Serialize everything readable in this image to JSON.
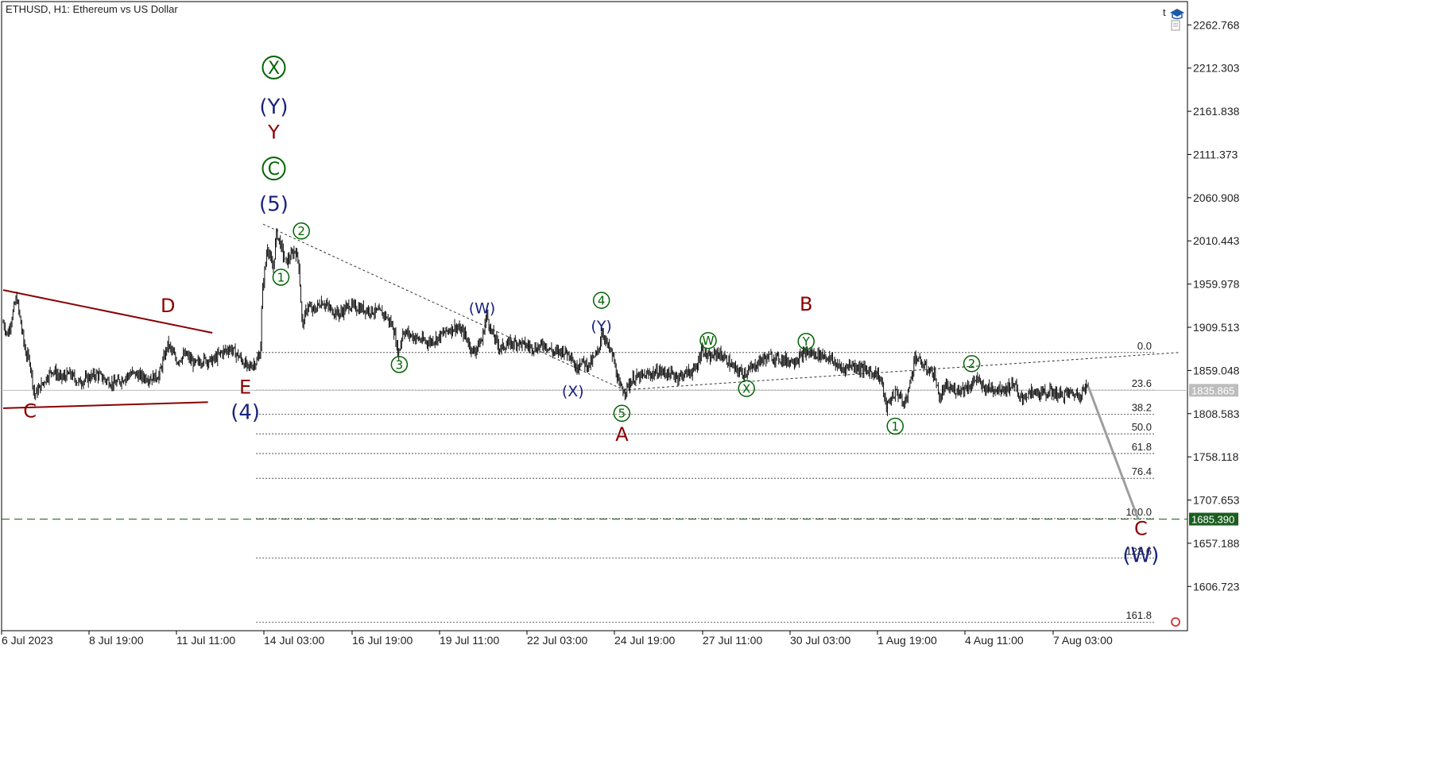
{
  "header": {
    "title": "ETHUSD, H1:  Ethereum vs US Dollar"
  },
  "toolbar": {
    "trade_label": "t"
  },
  "chart_data": {
    "type": "candlestick",
    "title": "ETHUSD, H1:  Ethereum vs US Dollar",
    "symbol": "ETHUSD",
    "timeframe": "H1",
    "ylim": [
      1555,
      2290
    ],
    "y_ticks": [
      "2262.768",
      "2212.303",
      "2161.838",
      "2111.373",
      "2060.908",
      "2010.443",
      "1959.978",
      "1909.513",
      "1859.048",
      "1808.583",
      "1758.118",
      "1707.653",
      "1657.188",
      "1606.723"
    ],
    "x_ticks": [
      "6 Jul 2023",
      "8 Jul 19:00",
      "11 Jul 11:00",
      "14 Jul 03:00",
      "16 Jul 19:00",
      "19 Jul 11:00",
      "22 Jul 03:00",
      "24 Jul 19:00",
      "27 Jul 11:00",
      "30 Jul 03:00",
      "1 Aug 19:00",
      "4 Aug 11:00",
      "7 Aug 03:00"
    ],
    "current_price": "1835.865",
    "target_price": "1685.390",
    "close_path": [
      [
        0,
        1915
      ],
      [
        0.5,
        1900
      ],
      [
        1.5,
        1945
      ],
      [
        2.5,
        1880
      ],
      [
        3,
        1870
      ],
      [
        3.5,
        1830
      ],
      [
        4.5,
        1845
      ],
      [
        5.5,
        1860
      ],
      [
        6.5,
        1850
      ],
      [
        7.5,
        1855
      ],
      [
        8.5,
        1845
      ],
      [
        9.5,
        1850
      ],
      [
        10.5,
        1855
      ],
      [
        11.5,
        1848
      ],
      [
        12.5,
        1843
      ],
      [
        13.5,
        1850
      ],
      [
        14.5,
        1856
      ],
      [
        15.5,
        1852
      ],
      [
        16.5,
        1850
      ],
      [
        17.5,
        1853
      ],
      [
        18.5,
        1890
      ],
      [
        19.5,
        1870
      ],
      [
        20.5,
        1878
      ],
      [
        21.5,
        1866
      ],
      [
        22.5,
        1872
      ],
      [
        23.5,
        1870
      ],
      [
        24.5,
        1880
      ],
      [
        25.5,
        1885
      ],
      [
        26.5,
        1875
      ],
      [
        27.5,
        1862
      ],
      [
        28.5,
        1870
      ],
      [
        28.9,
        1880
      ],
      [
        29.1,
        1950
      ],
      [
        29.7,
        2005
      ],
      [
        30.3,
        1975
      ],
      [
        30.7,
        2020
      ],
      [
        31.2,
        2005
      ],
      [
        31.7,
        1985
      ],
      [
        32.3,
        1992
      ],
      [
        32.8,
        2000
      ],
      [
        33.2,
        1985
      ],
      [
        33.6,
        1910
      ],
      [
        34.2,
        1935
      ],
      [
        34.8,
        1928
      ],
      [
        35.8,
        1940
      ],
      [
        36.8,
        1930
      ],
      [
        37.8,
        1925
      ],
      [
        38.8,
        1935
      ],
      [
        39.8,
        1932
      ],
      [
        40.8,
        1930
      ],
      [
        41.8,
        1928
      ],
      [
        42.8,
        1925
      ],
      [
        43.8,
        1910
      ],
      [
        44.4,
        1878
      ],
      [
        44.9,
        1905
      ],
      [
        45.8,
        1900
      ],
      [
        46.8,
        1895
      ],
      [
        47.8,
        1892
      ],
      [
        48.8,
        1897
      ],
      [
        49.8,
        1905
      ],
      [
        50.8,
        1910
      ],
      [
        51.8,
        1902
      ],
      [
        52.8,
        1880
      ],
      [
        53.8,
        1895
      ],
      [
        54.3,
        1925
      ],
      [
        54.8,
        1905
      ],
      [
        55.8,
        1885
      ],
      [
        56.8,
        1890
      ],
      [
        57.8,
        1892
      ],
      [
        58.8,
        1888
      ],
      [
        59.8,
        1885
      ],
      [
        60.8,
        1890
      ],
      [
        61.8,
        1880
      ],
      [
        62.8,
        1882
      ],
      [
        63.8,
        1878
      ],
      [
        64.3,
        1860
      ],
      [
        64.8,
        1870
      ],
      [
        65.8,
        1865
      ],
      [
        66.8,
        1880
      ],
      [
        67.3,
        1905
      ],
      [
        67.8,
        1890
      ],
      [
        68.5,
        1875
      ],
      [
        69.2,
        1840
      ],
      [
        69.8,
        1835
      ],
      [
        70.8,
        1850
      ],
      [
        71.8,
        1852
      ],
      [
        72.8,
        1855
      ],
      [
        73.8,
        1858
      ],
      [
        74.8,
        1855
      ],
      [
        75.8,
        1852
      ],
      [
        76.8,
        1856
      ],
      [
        77.8,
        1860
      ],
      [
        78.5,
        1885
      ],
      [
        79.3,
        1872
      ],
      [
        80.2,
        1880
      ],
      [
        81.2,
        1872
      ],
      [
        82.2,
        1860
      ],
      [
        83.2,
        1856
      ],
      [
        84.2,
        1862
      ],
      [
        85.2,
        1872
      ],
      [
        86.2,
        1875
      ],
      [
        87.2,
        1873
      ],
      [
        88.2,
        1870
      ],
      [
        89.2,
        1872
      ],
      [
        90.2,
        1880
      ],
      [
        91.2,
        1878
      ],
      [
        92.2,
        1877
      ],
      [
        93.2,
        1870
      ],
      [
        94.2,
        1860
      ],
      [
        95.2,
        1866
      ],
      [
        96.2,
        1862
      ],
      [
        97.2,
        1858
      ],
      [
        98.2,
        1855
      ],
      [
        98.7,
        1845
      ],
      [
        99.2,
        1815
      ],
      [
        99.8,
        1828
      ],
      [
        100.4,
        1835
      ],
      [
        101.2,
        1818
      ],
      [
        101.8,
        1840
      ],
      [
        102.4,
        1875
      ],
      [
        102.9,
        1870
      ],
      [
        103.6,
        1862
      ],
      [
        104.6,
        1855
      ],
      [
        105.2,
        1825
      ],
      [
        105.8,
        1840
      ],
      [
        106.8,
        1836
      ],
      [
        107.8,
        1838
      ],
      [
        108.8,
        1842
      ],
      [
        109.4,
        1852
      ],
      [
        109.8,
        1840
      ],
      [
        110.8,
        1838
      ],
      [
        111.8,
        1838
      ],
      [
        112.8,
        1838
      ],
      [
        113.6,
        1845
      ],
      [
        114.1,
        1825
      ],
      [
        114.8,
        1830
      ],
      [
        115.8,
        1833
      ],
      [
        116.8,
        1832
      ],
      [
        117.8,
        1834
      ],
      [
        118.8,
        1830
      ],
      [
        119.8,
        1833
      ],
      [
        120.8,
        1830
      ],
      [
        121.5,
        1838
      ],
      [
        121.9,
        1840
      ]
    ],
    "forecast": {
      "from": [
        121.9,
        1840
      ],
      "to": [
        127.5,
        1685.39
      ]
    },
    "fibonacci": {
      "levels": [
        {
          "label": "0.0",
          "price": 1880.0
        },
        {
          "label": "23.6",
          "price": 1836.0
        },
        {
          "label": "38.2",
          "price": 1808.0
        },
        {
          "label": "50.0",
          "price": 1785.0
        },
        {
          "label": "61.8",
          "price": 1762.0
        },
        {
          "label": "76.4",
          "price": 1733.0
        },
        {
          "label": "100.0",
          "price": 1686.0
        },
        {
          "label": "123.6",
          "price": 1640.0
        },
        {
          "label": "161.8",
          "price": 1565.0
        }
      ]
    },
    "trendlines": [
      {
        "name": "triangle-top-line",
        "color": "#8b0000",
        "from": [
          0,
          1953
        ],
        "to": [
          23.5,
          1903
        ]
      },
      {
        "name": "triangle-bottom-line",
        "color": "#8b0000",
        "from": [
          0,
          1815
        ],
        "to": [
          23,
          1822
        ]
      },
      {
        "name": "channel-top-line",
        "color": "#333333",
        "dashed": true,
        "from": [
          29.2,
          2030
        ],
        "to": [
          70,
          1835
        ]
      },
      {
        "name": "channel-bottom-line",
        "color": "#333333",
        "dashed": true,
        "from": [
          69.2,
          1836
        ],
        "to": [
          132,
          1880
        ]
      }
    ],
    "wave_labels": [
      {
        "text": "C",
        "price": 1812,
        "i": 3,
        "color": "#8b0000",
        "style": "letter"
      },
      {
        "text": "D",
        "price": 1935,
        "i": 18.5,
        "color": "#8b0000",
        "style": "letter"
      },
      {
        "text": "E",
        "price": 1840,
        "i": 27.2,
        "color": "#8b0000",
        "style": "letter"
      },
      {
        "text": "(4)",
        "price": 1811,
        "i": 27.2,
        "color": "#1a237e",
        "style": "paren"
      },
      {
        "text": "(5)",
        "price": 2054,
        "i": 30.4,
        "color": "#1a237e",
        "style": "paren"
      },
      {
        "text": "C",
        "price": 2095,
        "i": 30.4,
        "color": "#006400",
        "style": "circle"
      },
      {
        "text": "Y",
        "price": 2138,
        "i": 30.4,
        "color": "#8b0000",
        "style": "letter"
      },
      {
        "text": "(Y)",
        "price": 2168,
        "i": 30.4,
        "color": "#1a237e",
        "style": "paren"
      },
      {
        "text": "X",
        "price": 2213,
        "i": 30.4,
        "color": "#006400",
        "style": "circle"
      },
      {
        "text": "1",
        "price": 1968,
        "i": 31.2,
        "color": "#006400",
        "style": "circle-small"
      },
      {
        "text": "2",
        "price": 2022,
        "i": 33.5,
        "color": "#006400",
        "style": "circle-small"
      },
      {
        "text": "3",
        "price": 1866,
        "i": 44.5,
        "color": "#006400",
        "style": "circle-small"
      },
      {
        "text": "(W)",
        "price": 1932,
        "i": 53.8,
        "color": "#1a237e",
        "style": "paren-small"
      },
      {
        "text": "4",
        "price": 1941,
        "i": 67.2,
        "color": "#006400",
        "style": "circle-small"
      },
      {
        "text": "(Y)",
        "price": 1911,
        "i": 67.2,
        "color": "#1a237e",
        "style": "paren-small"
      },
      {
        "text": "(X)",
        "price": 1835,
        "i": 64.0,
        "color": "#1a237e",
        "style": "paren-small"
      },
      {
        "text": "5",
        "price": 1809,
        "i": 69.5,
        "color": "#006400",
        "style": "circle-small"
      },
      {
        "text": "A",
        "price": 1785,
        "i": 69.5,
        "color": "#8b0000",
        "style": "letter"
      },
      {
        "text": "W",
        "price": 1894,
        "i": 79.2,
        "color": "#006400",
        "style": "circle-small"
      },
      {
        "text": "X",
        "price": 1838,
        "i": 83.5,
        "color": "#006400",
        "style": "circle-small"
      },
      {
        "text": "Y",
        "price": 1893,
        "i": 90.2,
        "color": "#006400",
        "style": "circle-small"
      },
      {
        "text": "B",
        "price": 1937,
        "i": 90.2,
        "color": "#8b0000",
        "style": "letter"
      },
      {
        "text": "1",
        "price": 1794,
        "i": 100.2,
        "color": "#006400",
        "style": "circle-small"
      },
      {
        "text": "2",
        "price": 1867,
        "i": 108.8,
        "color": "#006400",
        "style": "circle-small"
      },
      {
        "text": "C",
        "price": 1675,
        "i": 127.8,
        "color": "#8b0000",
        "style": "letter"
      },
      {
        "text": "(W)",
        "price": 1644,
        "i": 127.8,
        "color": "#1a237e",
        "style": "paren"
      }
    ]
  }
}
